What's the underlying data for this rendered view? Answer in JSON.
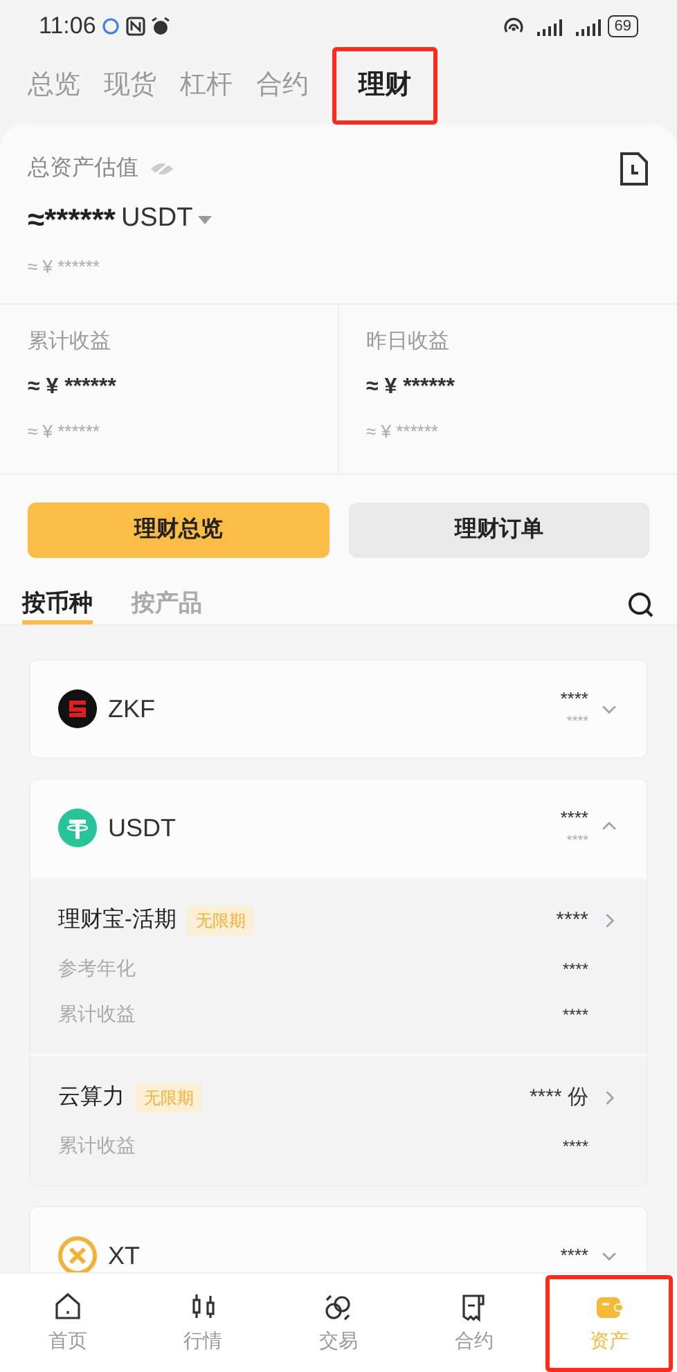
{
  "status_bar": {
    "time": "11:06",
    "battery": "69"
  },
  "tabs": [
    {
      "label": "总览",
      "selected": false,
      "highlighted": false
    },
    {
      "label": "现货",
      "selected": false,
      "highlighted": false
    },
    {
      "label": "杠杆",
      "selected": false,
      "highlighted": false
    },
    {
      "label": "合约",
      "selected": false,
      "highlighted": false
    },
    {
      "label": "理财",
      "selected": true,
      "highlighted": true
    }
  ],
  "summary": {
    "label": "总资产估值",
    "value": "≈******",
    "currency": "USDT",
    "fiat": "≈ ¥ ******"
  },
  "earnings": [
    {
      "label": "累计收益",
      "value": "≈ ¥ ******",
      "fiat": "≈ ¥ ******"
    },
    {
      "label": "昨日收益",
      "value": "≈ ¥ ******",
      "fiat": "≈ ¥ ******"
    }
  ],
  "actions": [
    {
      "label": "理财总览",
      "selected": true
    },
    {
      "label": "理财订单",
      "selected": false
    }
  ],
  "view_tabs": [
    {
      "label": "按币种",
      "selected": true
    },
    {
      "label": "按产品",
      "selected": false
    }
  ],
  "assets": [
    {
      "coin": "ZKF",
      "amount": "****",
      "sub": "****",
      "expanded": false
    },
    {
      "coin": "USDT",
      "amount": "****",
      "sub": "****",
      "expanded": true,
      "products": [
        {
          "name": "理财宝-活期",
          "tag": "无限期",
          "value": "****",
          "rows": [
            {
              "label": "参考年化",
              "value": "****"
            },
            {
              "label": "累计收益",
              "value": "****"
            }
          ]
        },
        {
          "name": "云算力",
          "tag": "无限期",
          "value": "**** 份",
          "rows": [
            {
              "label": "累计收益",
              "value": "****"
            }
          ]
        }
      ]
    },
    {
      "coin": "XT",
      "amount": "****",
      "expanded": false
    }
  ],
  "nav": [
    {
      "label": "首页",
      "selected": false,
      "highlighted": false
    },
    {
      "label": "行情",
      "selected": false,
      "highlighted": false
    },
    {
      "label": "交易",
      "selected": false,
      "highlighted": false
    },
    {
      "label": "合约",
      "selected": false,
      "highlighted": false
    },
    {
      "label": "资产",
      "selected": true,
      "highlighted": true
    }
  ]
}
